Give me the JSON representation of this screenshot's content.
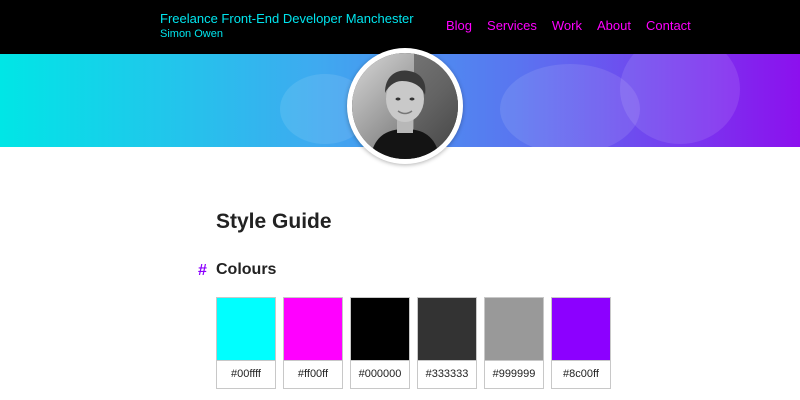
{
  "header": {
    "site_title": "Freelance Front-End Developer Manchester",
    "site_subtitle": "Simon Owen",
    "nav": [
      {
        "label": "Blog"
      },
      {
        "label": "Services"
      },
      {
        "label": "Work"
      },
      {
        "label": "About"
      },
      {
        "label": "Contact"
      }
    ]
  },
  "hero": {
    "gradient_colors": [
      "#00e6e6",
      "#3fa9f0",
      "#5a74f0",
      "#8c10ee"
    ],
    "avatar_icon": "profile-photo"
  },
  "main": {
    "title": "Style Guide",
    "sections": [
      {
        "hash": "#",
        "title": "Colours",
        "swatches": [
          {
            "color": "#00ffff",
            "label": "#00ffff"
          },
          {
            "color": "#ff00ff",
            "label": "#ff00ff"
          },
          {
            "color": "#000000",
            "label": "#000000"
          },
          {
            "color": "#333333",
            "label": "#333333"
          },
          {
            "color": "#999999",
            "label": "#999999"
          },
          {
            "color": "#8c00ff",
            "label": "#8c00ff"
          }
        ]
      }
    ]
  },
  "colors": {
    "header_bg": "#000000",
    "brand": "#00e5ee",
    "nav_link": "#ff00ff",
    "accent": "#8c00ff"
  }
}
